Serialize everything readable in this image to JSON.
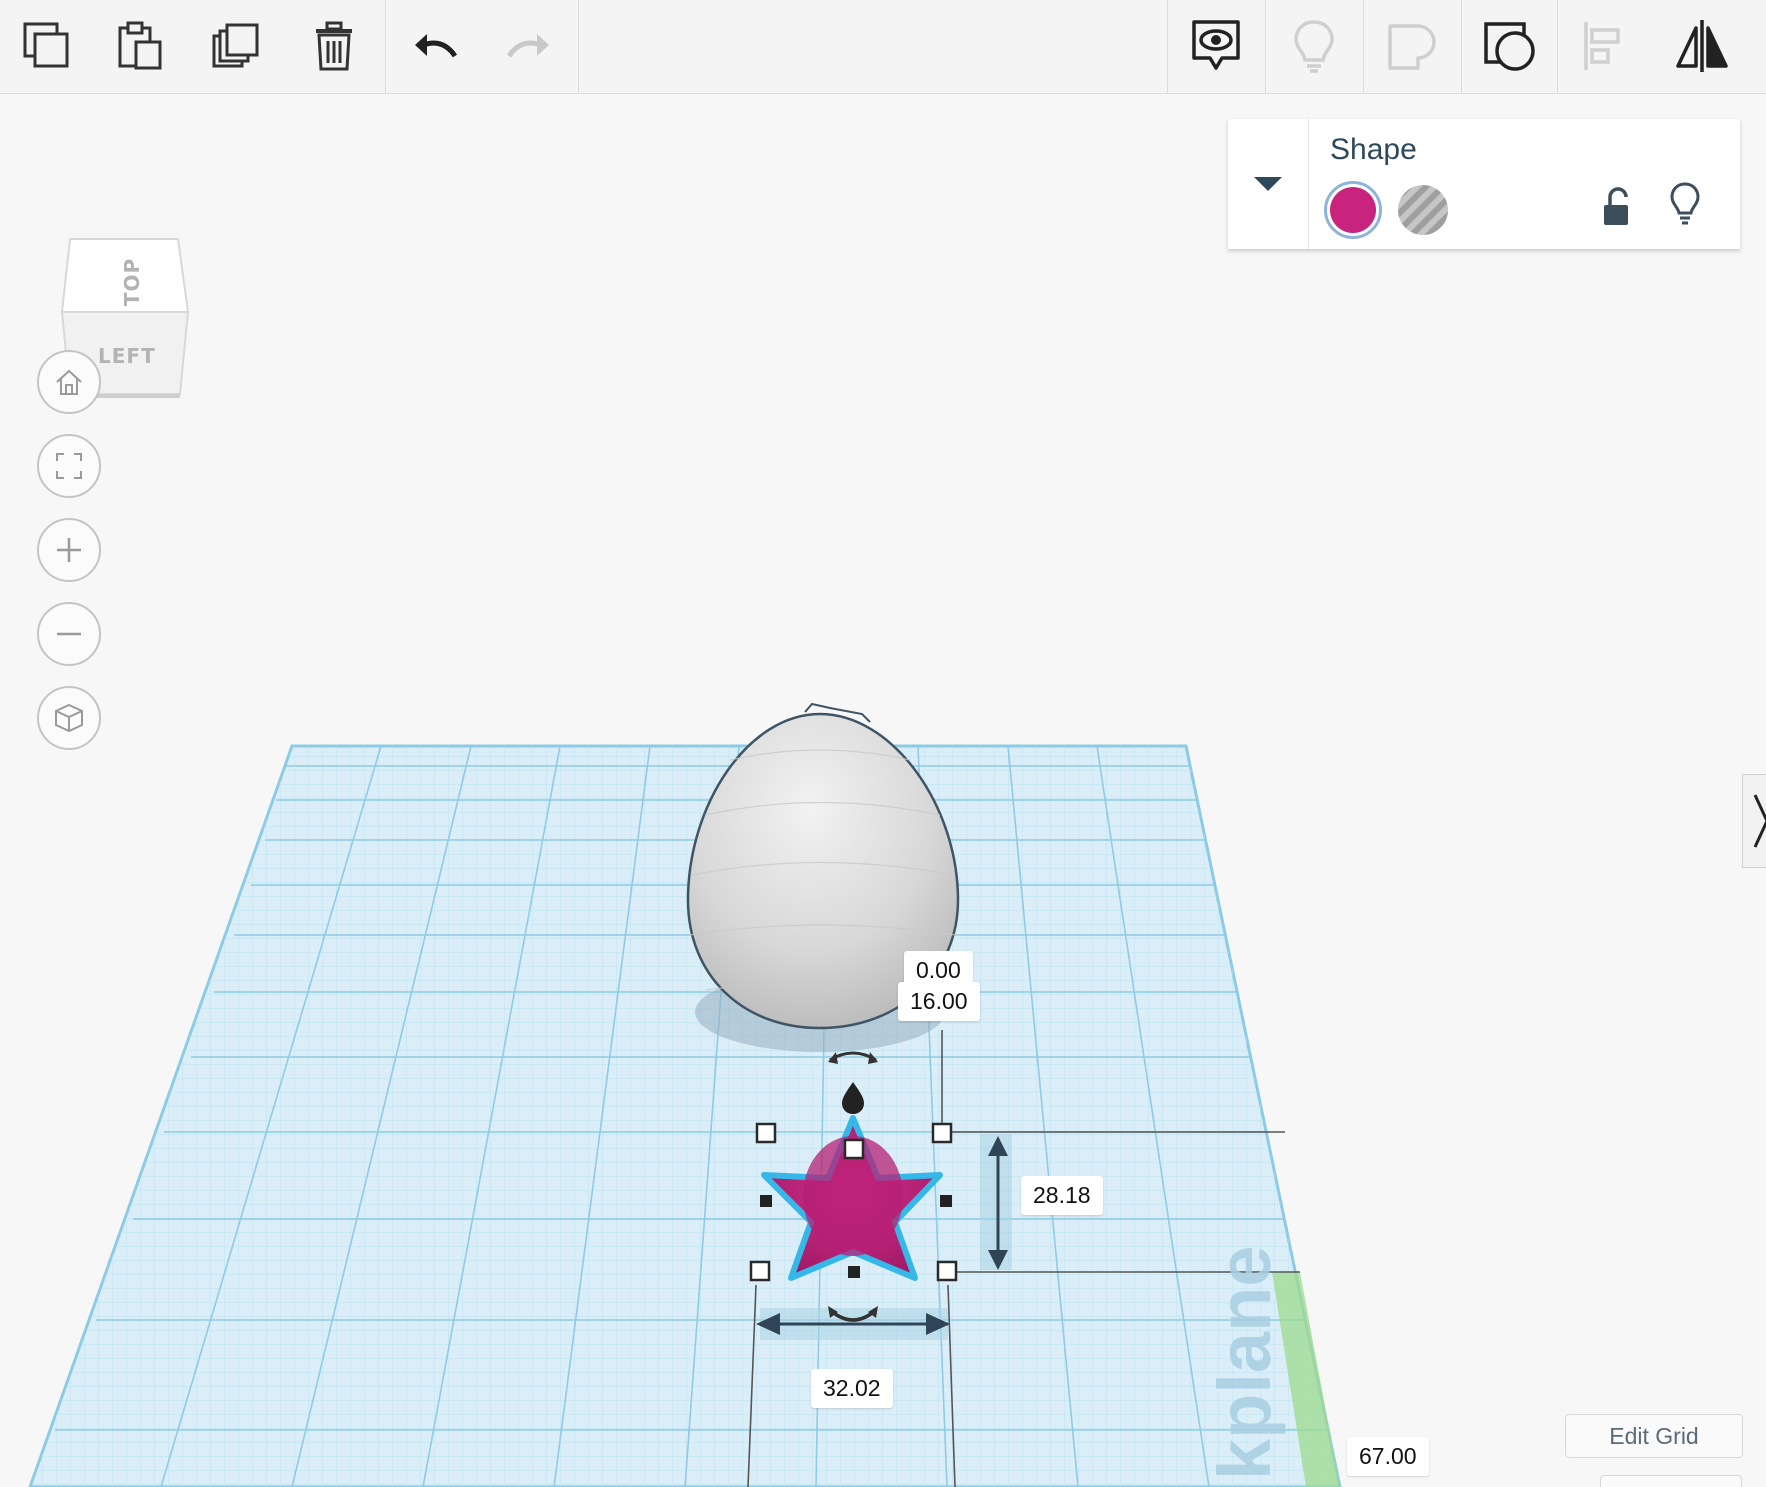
{
  "toolbar": {
    "left_tools": [
      {
        "name": "copy",
        "icon": "copy-icon",
        "enabled": true
      },
      {
        "name": "paste",
        "icon": "paste-icon",
        "enabled": true
      },
      {
        "name": "duplicate",
        "icon": "duplicate-icon",
        "enabled": true
      },
      {
        "name": "delete",
        "icon": "trash-icon",
        "enabled": true
      },
      {
        "name": "undo",
        "icon": "undo-icon",
        "enabled": true
      },
      {
        "name": "redo",
        "icon": "redo-icon",
        "enabled": false
      }
    ],
    "right_tools": [
      {
        "name": "notes",
        "icon": "note-eye-icon",
        "enabled": true
      },
      {
        "name": "show-all",
        "icon": "lightbulb-icon",
        "enabled": false
      },
      {
        "name": "group",
        "icon": "group-icon",
        "enabled": false
      },
      {
        "name": "ungroup",
        "icon": "ungroup-icon",
        "enabled": true
      },
      {
        "name": "align",
        "icon": "align-icon",
        "enabled": false
      },
      {
        "name": "mirror",
        "icon": "mirror-icon",
        "enabled": true
      }
    ]
  },
  "view_cube": {
    "top_label": "TOP",
    "left_label": "LEFT"
  },
  "nav_controls": [
    "home-icon",
    "fit-view-icon",
    "zoom-in-icon",
    "zoom-out-icon",
    "perspective-cube-icon"
  ],
  "inspector": {
    "title": "Shape",
    "solid_color": "#c8247e",
    "hole_swatch": "hole-pattern"
  },
  "dimensions": {
    "elevation": "0.00",
    "gap": "16.00",
    "height": "28.18",
    "width": "32.02",
    "position": "67.00"
  },
  "workplane_label": "kplane",
  "edit_grid_label": "Edit Grid",
  "colors": {
    "accent": "#c8247e",
    "grid": "#a9d6ea",
    "selection": "#3fb8e8"
  }
}
